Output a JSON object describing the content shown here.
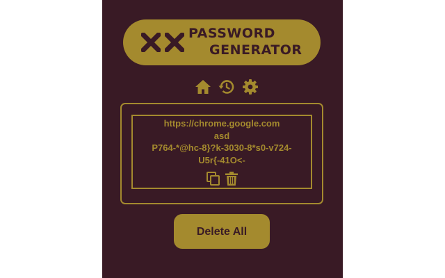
{
  "logo": {
    "title_line1": "PASSWORD",
    "title_line2": "GENERATOR",
    "icon": "x-marks-icon"
  },
  "nav": {
    "items": [
      {
        "icon": "home-icon"
      },
      {
        "icon": "history-icon"
      },
      {
        "icon": "gear-icon"
      }
    ]
  },
  "history": {
    "entries": [
      {
        "site": "https://chrome.google.com",
        "username": "asd",
        "password_line1": "P764-*@hc-8}?k-3030-8*s0-v724-",
        "password_line2": "U5r{-41O<-",
        "actions": [
          "copy-icon",
          "trash-icon"
        ]
      }
    ]
  },
  "delete_all_label": "Delete All",
  "colors": {
    "background": "#391a25",
    "accent": "#a48a2e"
  }
}
